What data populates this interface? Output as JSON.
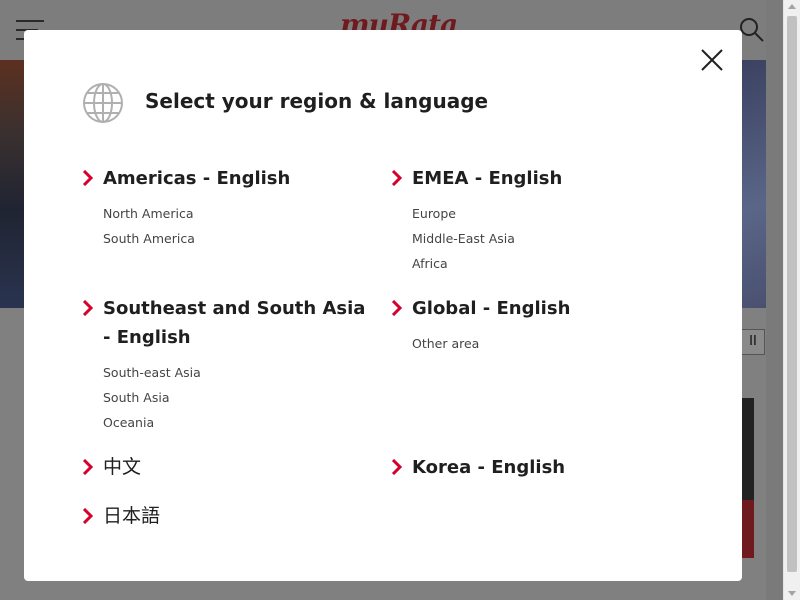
{
  "background": {
    "logo_text": "muRata",
    "pause_label": "II"
  },
  "modal": {
    "title": "Select your region & language",
    "close_label": "×",
    "accent_color": "#d6002a",
    "regions": [
      {
        "title": "Americas - English",
        "items": [
          "North America",
          "South America"
        ]
      },
      {
        "title": "EMEA - English",
        "items": [
          "Europe",
          "Middle-East Asia",
          "Africa"
        ]
      },
      {
        "title": "Southeast and South Asia - English",
        "items": [
          "South-east Asia",
          "South Asia",
          "Oceania"
        ]
      },
      {
        "title": "Global - English",
        "items": [
          "Other area"
        ]
      },
      {
        "title": "中文",
        "items": []
      },
      {
        "title": "Korea - English",
        "items": []
      },
      {
        "title": "日本語",
        "items": []
      }
    ]
  }
}
